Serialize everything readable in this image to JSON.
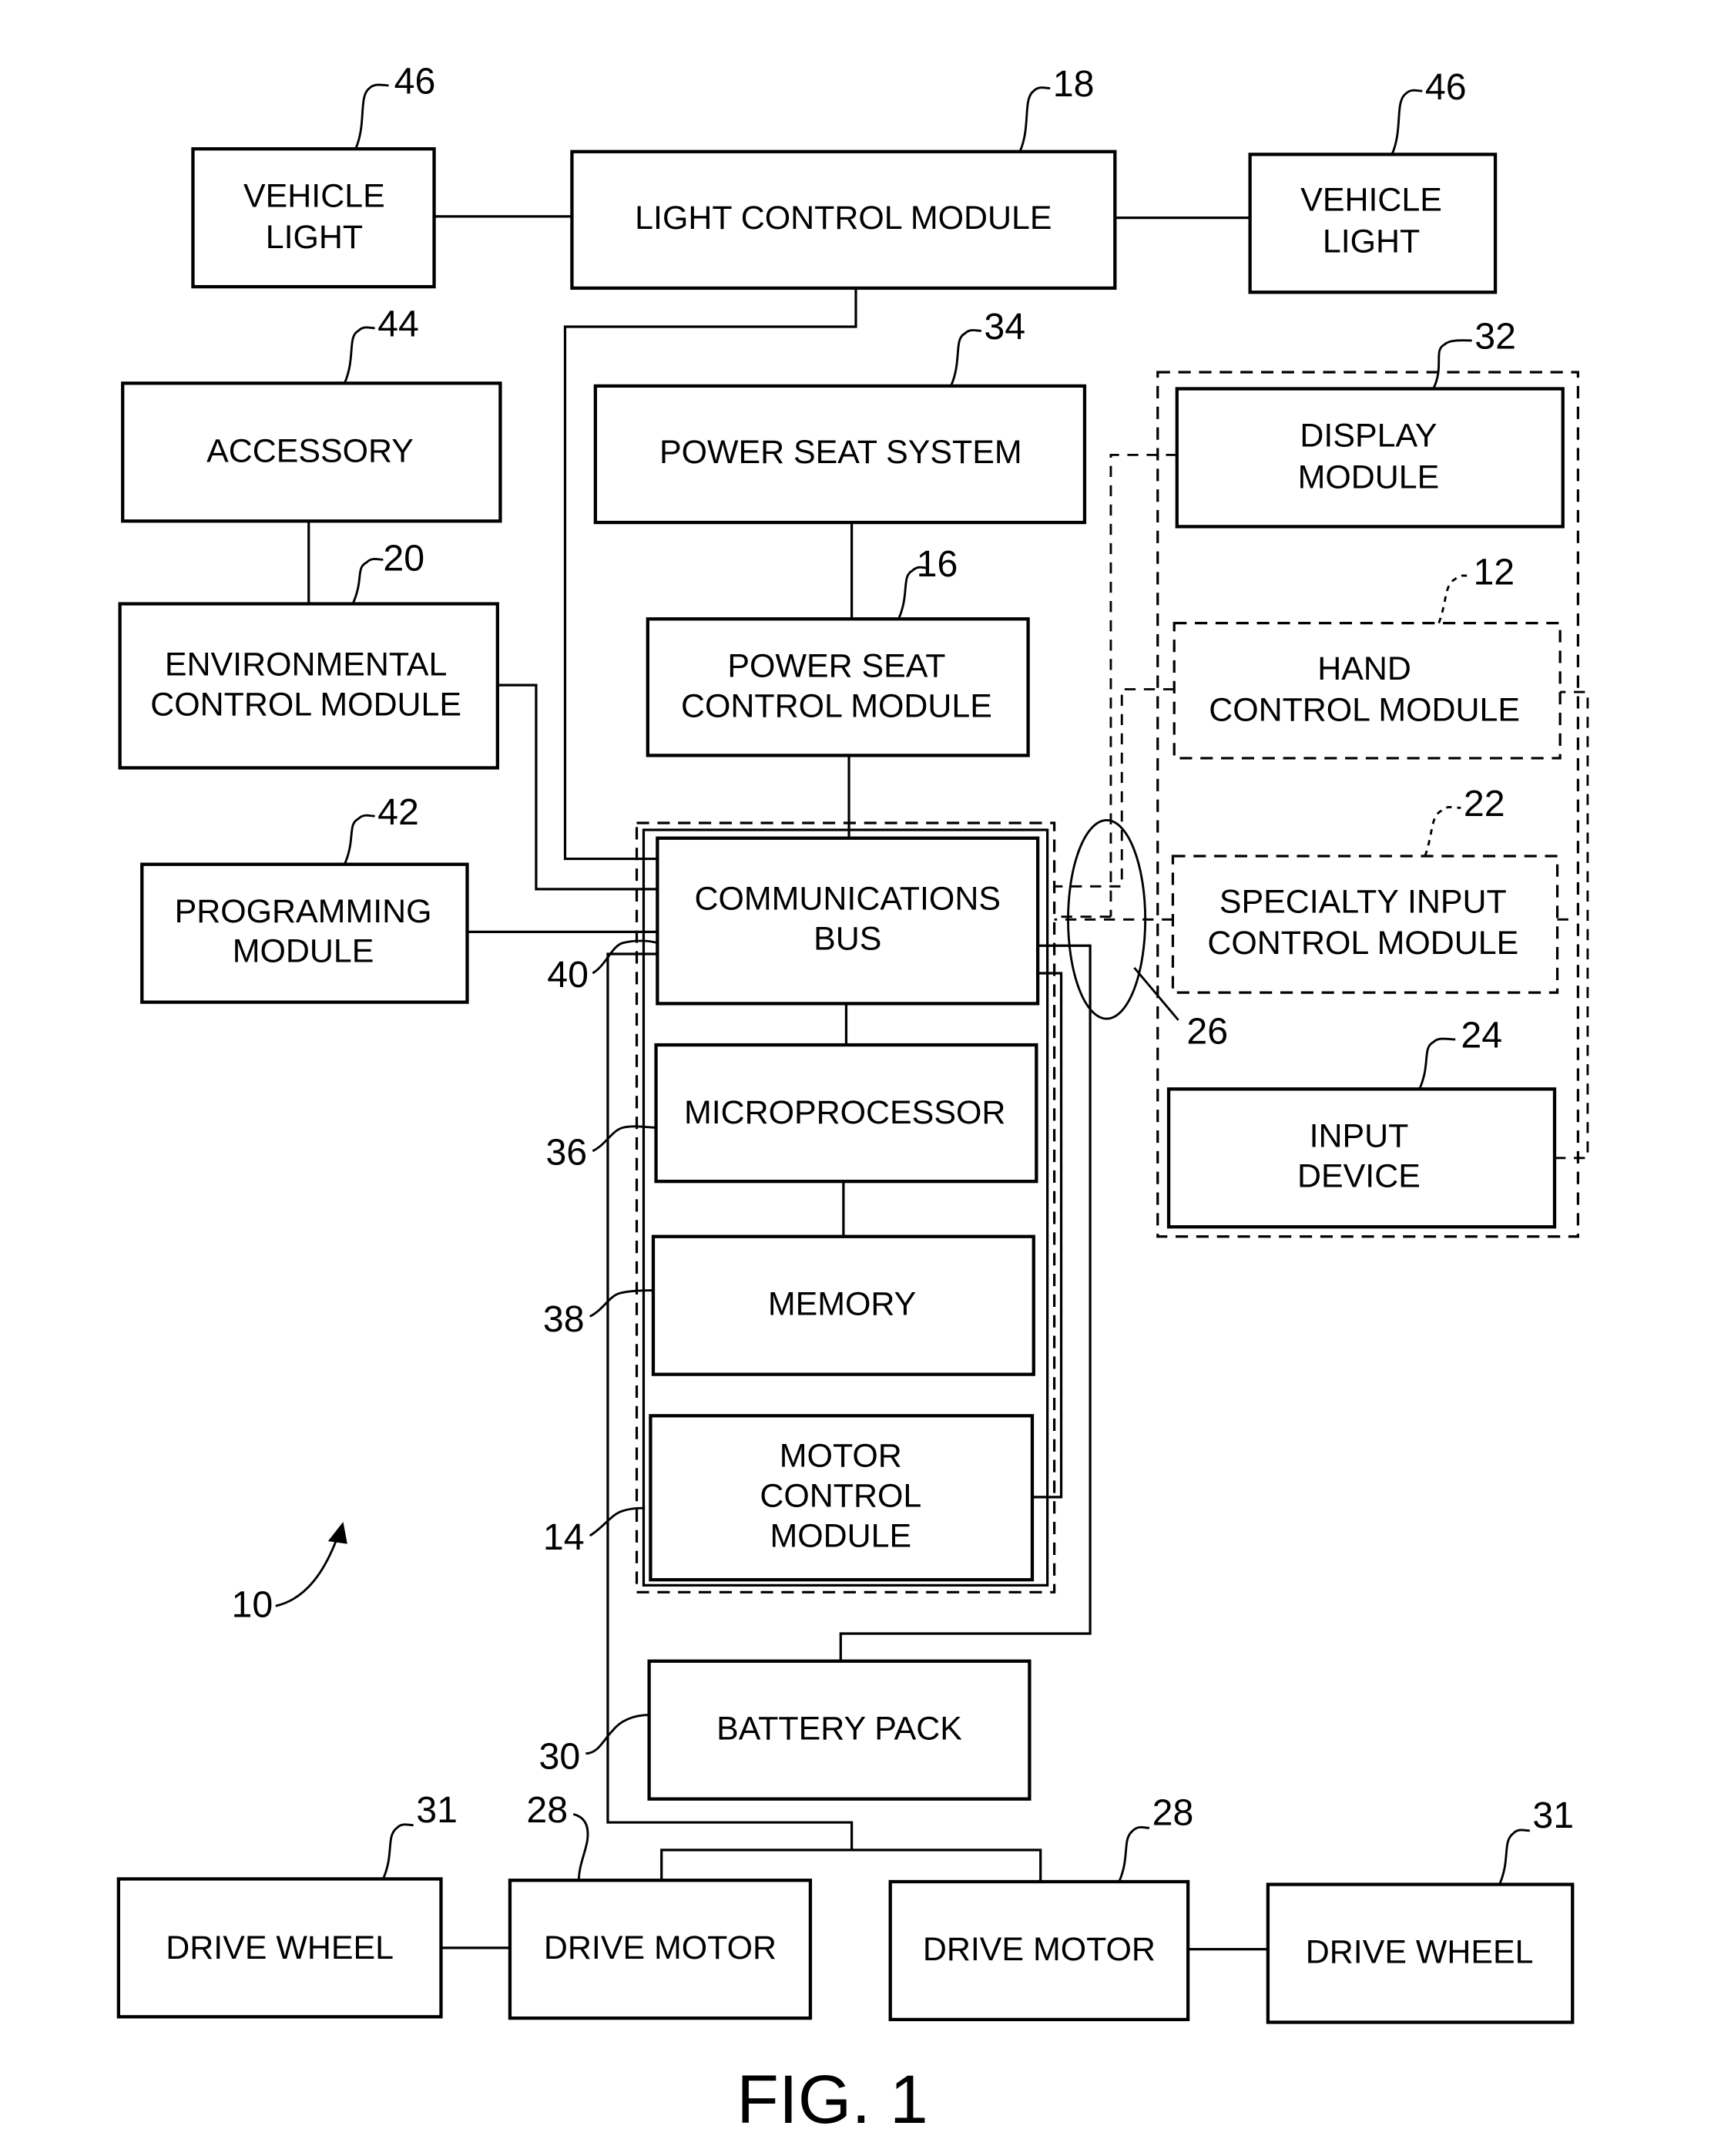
{
  "figure": {
    "caption": "FIG. 1",
    "system_ref": "10"
  },
  "blocks": {
    "vehicle_light_left": {
      "lines": [
        "VEHICLE",
        "LIGHT"
      ],
      "ref": "46"
    },
    "light_control_module": {
      "lines": [
        "LIGHT CONTROL MODULE"
      ],
      "ref": "18"
    },
    "vehicle_light_right": {
      "lines": [
        "VEHICLE",
        "LIGHT"
      ],
      "ref": "46"
    },
    "accessory": {
      "lines": [
        "ACCESSORY"
      ],
      "ref": "44"
    },
    "power_seat_system": {
      "lines": [
        "POWER SEAT SYSTEM"
      ],
      "ref": "34"
    },
    "display_module": {
      "lines": [
        "DISPLAY",
        "MODULE"
      ],
      "ref": "32"
    },
    "environmental_control_module": {
      "lines": [
        "ENVIRONMENTAL",
        "CONTROL MODULE"
      ],
      "ref": "20"
    },
    "power_seat_control_module": {
      "lines": [
        "POWER SEAT",
        "CONTROL MODULE"
      ],
      "ref": "16"
    },
    "hand_control_module": {
      "lines": [
        "HAND",
        "CONTROL MODULE"
      ],
      "ref": "12"
    },
    "programming_module": {
      "lines": [
        "PROGRAMMING",
        "MODULE"
      ],
      "ref": "42"
    },
    "communications_bus": {
      "lines": [
        "COMMUNICATIONS",
        "BUS"
      ],
      "ref": "40"
    },
    "specialty_input_control_module": {
      "lines": [
        "SPECIALTY INPUT",
        "CONTROL MODULE"
      ],
      "ref": "22"
    },
    "microprocessor": {
      "lines": [
        "MICROPROCESSOR"
      ],
      "ref": "36"
    },
    "input_device": {
      "lines": [
        "INPUT",
        "DEVICE"
      ],
      "ref": "24"
    },
    "memory": {
      "lines": [
        "MEMORY"
      ],
      "ref": "38"
    },
    "motor_control_module": {
      "lines": [
        "MOTOR",
        "CONTROL",
        "MODULE"
      ],
      "ref": "14"
    },
    "battery_pack": {
      "lines": [
        "BATTERY PACK"
      ],
      "ref": "30"
    },
    "drive_wheel_left": {
      "lines": [
        "DRIVE WHEEL"
      ],
      "ref": "31"
    },
    "drive_motor_left": {
      "lines": [
        "DRIVE MOTOR"
      ],
      "ref": "28"
    },
    "drive_motor_right": {
      "lines": [
        "DRIVE MOTOR"
      ],
      "ref": "28"
    },
    "drive_wheel_right": {
      "lines": [
        "DRIVE WHEEL"
      ],
      "ref": "31"
    }
  },
  "annotations": {
    "connection_bundle_ref": "26"
  }
}
